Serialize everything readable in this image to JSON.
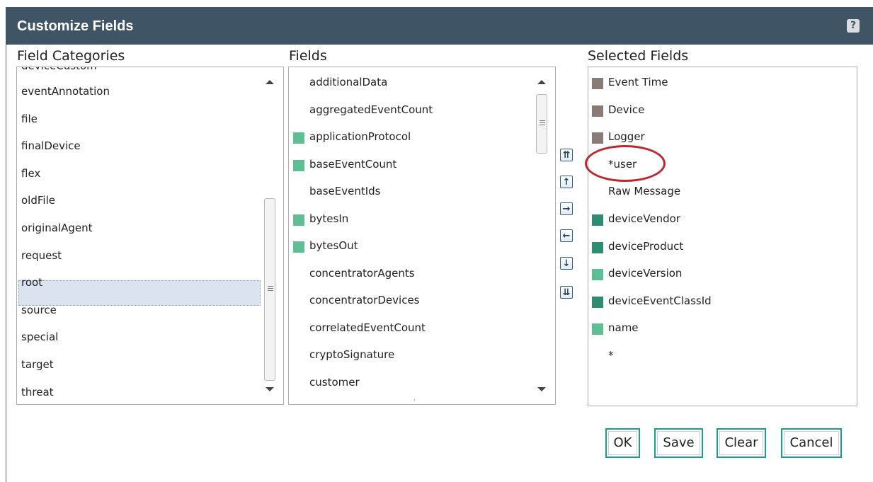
{
  "dialog": {
    "title": "Customize Fields",
    "help_label": "?"
  },
  "headers": {
    "categories": "Field Categories",
    "fields": "Fields",
    "selected": "Selected Fields"
  },
  "categories": {
    "partial_top": "deviceCustom",
    "items": [
      "eventAnnotation",
      "file",
      "finalDevice",
      "flex",
      "oldFile",
      "originalAgent",
      "request",
      "root",
      "source",
      "special",
      "target",
      "threat"
    ],
    "selected": "root"
  },
  "fields": {
    "items": [
      {
        "label": "additionalData",
        "marker": ""
      },
      {
        "label": "aggregatedEventCount",
        "marker": ""
      },
      {
        "label": "applicationProtocol",
        "marker": "#5ebf94"
      },
      {
        "label": "baseEventCount",
        "marker": "#5ebf94"
      },
      {
        "label": "baseEventIds",
        "marker": ""
      },
      {
        "label": "bytesIn",
        "marker": "#5ebf94"
      },
      {
        "label": "bytesOut",
        "marker": "#5ebf94"
      },
      {
        "label": "concentratorAgents",
        "marker": ""
      },
      {
        "label": "concentratorDevices",
        "marker": ""
      },
      {
        "label": "correlatedEventCount",
        "marker": ""
      },
      {
        "label": "cryptoSignature",
        "marker": ""
      },
      {
        "label": "customer",
        "marker": ""
      }
    ]
  },
  "selected_fields": {
    "items": [
      {
        "label": "Event Time",
        "marker": "#8a7b76"
      },
      {
        "label": "Device",
        "marker": "#8a7b76"
      },
      {
        "label": "Logger",
        "marker": "#8a7b76"
      },
      {
        "label": "*user",
        "marker": ""
      },
      {
        "label": "Raw Message",
        "marker": ""
      },
      {
        "label": "deviceVendor",
        "marker": "#2e8c72"
      },
      {
        "label": "deviceProduct",
        "marker": "#2e8c72"
      },
      {
        "label": "deviceVersion",
        "marker": "#5ebf94"
      },
      {
        "label": "deviceEventClassId",
        "marker": "#2e8c72"
      },
      {
        "label": "name",
        "marker": "#5ebf94"
      },
      {
        "label": "*",
        "marker": ""
      }
    ]
  },
  "move_buttons": [
    {
      "name": "move-top-button",
      "glyph": "⇈"
    },
    {
      "name": "move-up-button",
      "glyph": "↑"
    },
    {
      "name": "add-field-button",
      "glyph": "→"
    },
    {
      "name": "remove-field-button",
      "glyph": "←"
    },
    {
      "name": "move-down-button",
      "glyph": "↓"
    },
    {
      "name": "move-bottom-button",
      "glyph": "⇊"
    }
  ],
  "buttons": {
    "ok": "OK",
    "save": "Save",
    "clear": "Clear",
    "cancel": "Cancel"
  },
  "colors": {
    "titlebar": "#3f5566",
    "button_border": "#19a08a",
    "selection": "#dbe3f1",
    "highlight_ring": "#c0272d"
  }
}
